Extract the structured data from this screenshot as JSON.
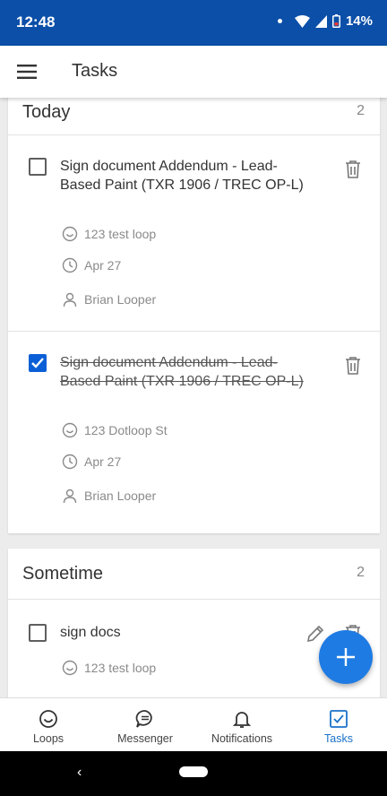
{
  "status_bar": {
    "time": "12:48",
    "battery": "14%"
  },
  "app_bar": {
    "title": "Tasks"
  },
  "sections": [
    {
      "heading": "Today",
      "count": "2",
      "tasks": [
        {
          "title": "Sign document Addendum - Lead-Based Paint (TXR 1906 / TREC OP-L)",
          "completed": false,
          "loop": "123 test loop",
          "due": "Apr 27",
          "assignee": "Brian Looper"
        },
        {
          "title": "Sign document Addendum - Lead-Based Paint (TXR 1906 / TREC OP-L)",
          "completed": true,
          "loop": "123 Dotloop St",
          "due": "Apr 27",
          "assignee": "Brian Looper"
        }
      ]
    },
    {
      "heading": "Sometime",
      "count": "2",
      "tasks": [
        {
          "title": "sign docs",
          "completed": false,
          "loop": "123 test loop"
        }
      ]
    }
  ],
  "bottom_nav": [
    {
      "label": "Loops",
      "icon": "smile-icon"
    },
    {
      "label": "Messenger",
      "icon": "chat-icon"
    },
    {
      "label": "Notifications",
      "icon": "bell-icon"
    },
    {
      "label": "Tasks",
      "icon": "checkbox-icon",
      "active": true
    }
  ],
  "colors": {
    "status_bar": "#0b4fa8",
    "accent": "#1e7be3",
    "active_nav": "#1b72c9"
  }
}
